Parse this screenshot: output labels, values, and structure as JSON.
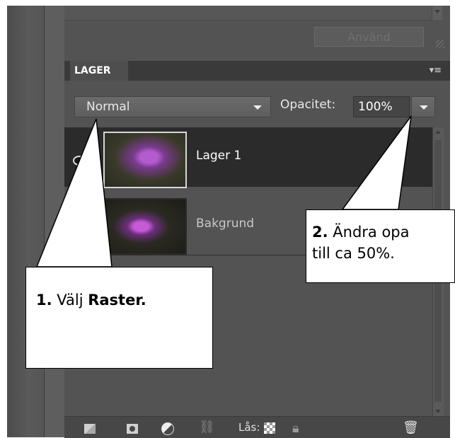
{
  "panel": {
    "apply_button": "Använd",
    "tab_label": "LAGER",
    "panel_menu_icon": "panel-menu-icon",
    "blend_mode": "Normal",
    "opacity_label": "Opacitet:",
    "opacity_value": "100%"
  },
  "layers": [
    {
      "name": "Lager 1",
      "selected": true,
      "visible": true
    },
    {
      "name": "Bakgrund",
      "selected": false,
      "visible": true
    }
  ],
  "toolbar": {
    "lock_label": "Lås:",
    "icons": [
      "new-layer-icon",
      "mask-icon",
      "adjustment-icon",
      "link-icon",
      "lock-transparency-icon",
      "lock-icon",
      "trash-icon"
    ]
  },
  "callouts": {
    "c1_num": "1.",
    "c1_text": " Välj ",
    "c1_bold": "Raster.",
    "c2_num": "2.",
    "c2_line1": " Ändra opa",
    "c2_line2": "till ca 50%."
  },
  "colors": {
    "panel_bg": "#535353",
    "selected_row": "#2b2b2b",
    "tab_bar": "#3a3a3a"
  }
}
